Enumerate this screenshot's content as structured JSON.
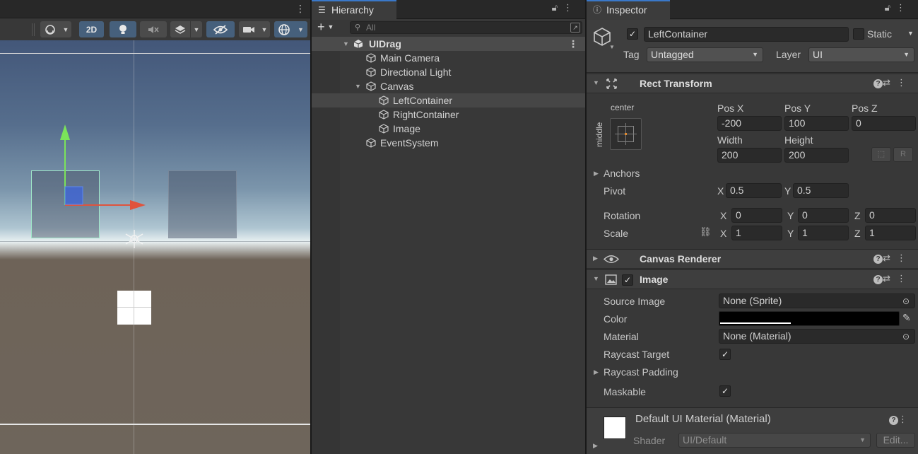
{
  "scene": {
    "toolbar": {
      "mode_2d_label": "2D"
    }
  },
  "hierarchy": {
    "tab_label": "Hierarchy",
    "search_placeholder": "All",
    "items": [
      {
        "label": "UIDrag",
        "kind": "scene",
        "depth": 0,
        "expanded": true
      },
      {
        "label": "Main Camera",
        "depth": 1
      },
      {
        "label": "Directional Light",
        "depth": 1
      },
      {
        "label": "Canvas",
        "depth": 1,
        "expanded": true
      },
      {
        "label": "LeftContainer",
        "depth": 2,
        "selected": true
      },
      {
        "label": "RightContainer",
        "depth": 2
      },
      {
        "label": "Image",
        "depth": 2
      },
      {
        "label": "EventSystem",
        "depth": 1
      }
    ]
  },
  "inspector": {
    "tab_label": "Inspector",
    "object_name": "LeftContainer",
    "active": true,
    "static_label": "Static",
    "tag_label": "Tag",
    "tag_value": "Untagged",
    "layer_label": "Layer",
    "layer_value": "UI",
    "rect_transform": {
      "title": "Rect Transform",
      "anchor_h": "center",
      "anchor_v": "middle",
      "pos_x_label": "Pos X",
      "pos_x": "-200",
      "pos_y_label": "Pos Y",
      "pos_y": "100",
      "pos_z_label": "Pos Z",
      "pos_z": "0",
      "width_label": "Width",
      "width": "200",
      "height_label": "Height",
      "height": "200",
      "r_button": "R",
      "anchors_label": "Anchors",
      "pivot_label": "Pivot",
      "pivot_x": "0.5",
      "pivot_y": "0.5",
      "rotation_label": "Rotation",
      "rot_x": "0",
      "rot_y": "0",
      "rot_z": "0",
      "scale_label": "Scale",
      "scale_x": "1",
      "scale_y": "1",
      "scale_z": "1",
      "x_label": "X",
      "y_label": "Y",
      "z_label": "Z"
    },
    "canvas_renderer": {
      "title": "Canvas Renderer"
    },
    "image": {
      "title": "Image",
      "enabled": true,
      "source_image_label": "Source Image",
      "source_image": "None (Sprite)",
      "color_label": "Color",
      "color": "#000000",
      "material_label": "Material",
      "material": "None (Material)",
      "raycast_target_label": "Raycast Target",
      "raycast_target": true,
      "raycast_padding_label": "Raycast Padding",
      "maskable_label": "Maskable",
      "maskable": true
    },
    "material_section": {
      "title": "Default UI Material (Material)",
      "shader_label": "Shader",
      "shader_value": "UI/Default",
      "edit_label": "Edit..."
    }
  }
}
